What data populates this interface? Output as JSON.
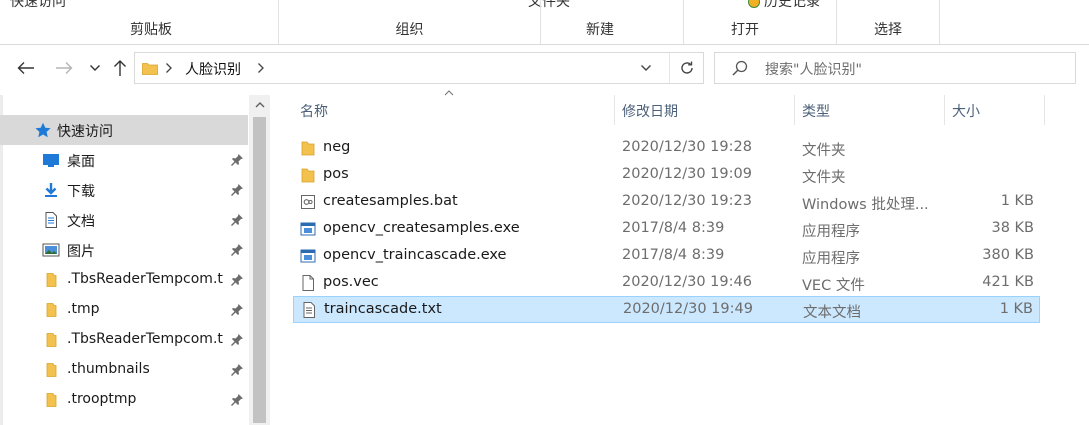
{
  "ribbon": {
    "top_left_text": "快速访问",
    "top_mid_text": "文件夹",
    "top_history_text": "历史记录",
    "groups": [
      "剪贴板",
      "组织",
      "新建",
      "打开",
      "选择"
    ]
  },
  "nav": {
    "back_icon": "arrow-left-icon",
    "forward_icon": "arrow-right-icon",
    "recent_icon": "chevron-down-icon",
    "up_icon": "arrow-up-icon",
    "breadcrumb": [
      "人脸识别"
    ],
    "search_placeholder": "搜索\"人脸识别\""
  },
  "sidebar": {
    "root": {
      "label": "快速访问",
      "icon": "star-icon"
    },
    "items": [
      {
        "label": "桌面",
        "icon": "desktop-icon",
        "pinned": true
      },
      {
        "label": "下载",
        "icon": "download-icon",
        "pinned": true
      },
      {
        "label": "文档",
        "icon": "document-icon",
        "pinned": true
      },
      {
        "label": "图片",
        "icon": "pictures-icon",
        "pinned": true
      },
      {
        "label": ".TbsReaderTempcom.t",
        "icon": "folder-icon",
        "pinned": true
      },
      {
        "label": ".tmp",
        "icon": "folder-icon",
        "pinned": true
      },
      {
        "label": ".TbsReaderTempcom.t",
        "icon": "folder-icon",
        "pinned": true
      },
      {
        "label": ".thumbnails",
        "icon": "folder-icon",
        "pinned": true
      },
      {
        "label": ".trooptmp",
        "icon": "folder-icon",
        "pinned": true
      }
    ]
  },
  "columns": {
    "name": "名称",
    "date": "修改日期",
    "type": "类型",
    "size": "大小"
  },
  "files": [
    {
      "name": "neg",
      "date": "2020/12/30 19:28",
      "type": "文件夹",
      "size": "",
      "icon": "folder-icon"
    },
    {
      "name": "pos",
      "date": "2020/12/30 19:09",
      "type": "文件夹",
      "size": "",
      "icon": "folder-icon"
    },
    {
      "name": "createsamples.bat",
      "date": "2020/12/30 19:23",
      "type": "Windows 批处理...",
      "size": "1 KB",
      "icon": "batch-file-icon"
    },
    {
      "name": "opencv_createsamples.exe",
      "date": "2017/8/4 8:39",
      "type": "应用程序",
      "size": "38 KB",
      "icon": "application-icon"
    },
    {
      "name": "opencv_traincascade.exe",
      "date": "2017/8/4 8:39",
      "type": "应用程序",
      "size": "380 KB",
      "icon": "application-icon"
    },
    {
      "name": "pos.vec",
      "date": "2020/12/30 19:46",
      "type": "VEC 文件",
      "size": "421 KB",
      "icon": "blank-file-icon"
    },
    {
      "name": "traincascade.txt",
      "date": "2020/12/30 19:49",
      "type": "文本文档",
      "size": "1 KB",
      "icon": "text-file-icon",
      "selected": true
    }
  ],
  "colors": {
    "selection": "#cce8ff",
    "selection_border": "#99d1ff",
    "folder": "#f2c14e",
    "sidebar_selected": "#d9d9d9"
  }
}
